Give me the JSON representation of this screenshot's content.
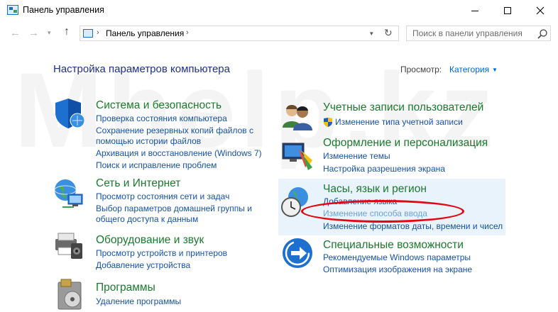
{
  "watermark": "Mhelp.kz",
  "window": {
    "title": "Панель управления"
  },
  "address_bar": {
    "path": "Панель управления"
  },
  "search": {
    "placeholder": "Поиск в панели управления"
  },
  "header": {
    "title": "Настройка параметров компьютера",
    "view_label": "Просмотр:",
    "view_value": "Категория"
  },
  "categories": {
    "security": {
      "title": "Система и безопасность",
      "links": [
        "Проверка состояния компьютера",
        "Сохранение резервных копий файлов с",
        "помощью истории файлов",
        "Архивация и восстановление (Windows 7)",
        "Поиск и исправление проблем"
      ]
    },
    "network": {
      "title": "Сеть и Интернет",
      "links": [
        "Просмотр состояния сети и задач",
        "Выбор параметров домашней группы и",
        "общего доступа к данным"
      ]
    },
    "hardware": {
      "title": "Оборудование и звук",
      "links": [
        "Просмотр устройств и принтеров",
        "Добавление устройства"
      ]
    },
    "programs": {
      "title": "Программы",
      "links": [
        "Удаление программы"
      ]
    },
    "accounts": {
      "title": "Учетные записи пользователей",
      "links": [
        "Изменение типа учетной записи"
      ]
    },
    "appearance": {
      "title": "Оформление и персонализация",
      "links": [
        "Изменение темы",
        "Настройка разрешения экрана"
      ]
    },
    "clock": {
      "title": "Часы, язык и регион",
      "links": [
        "Добавление языка",
        "Изменение способа ввода",
        "Изменение форматов даты, времени и чисел"
      ]
    },
    "ease": {
      "title": "Специальные возможности",
      "links": [
        "Рекомендуемые Windows параметры",
        "Оптимизация изображения на экране"
      ]
    }
  }
}
